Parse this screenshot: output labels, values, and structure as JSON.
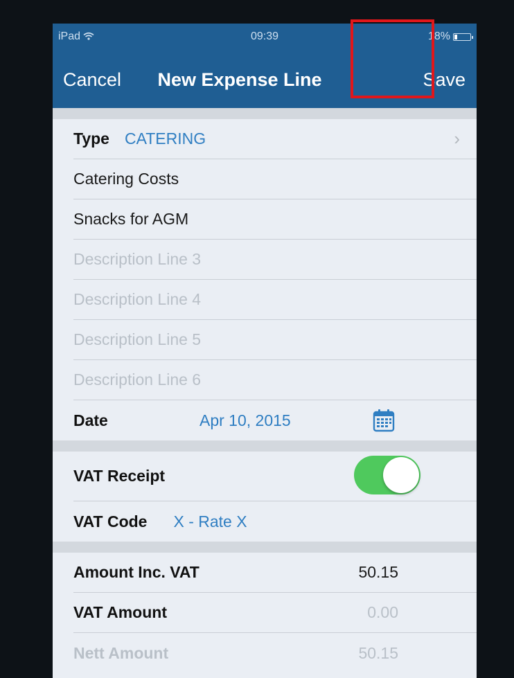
{
  "status_bar": {
    "device": "iPad",
    "time": "09:39",
    "battery": "18%",
    "battery_level": 0.18
  },
  "nav": {
    "cancel_label": "Cancel",
    "title": "New Expense Line",
    "save_label": "Save"
  },
  "form": {
    "type_label": "Type",
    "type_value": "CATERING",
    "description_1": "Catering Costs",
    "description_2": "Snacks for AGM",
    "description_3_placeholder": "Description Line 3",
    "description_4_placeholder": "Description Line 4",
    "description_5_placeholder": "Description Line 5",
    "description_6_placeholder": "Description Line 6",
    "date_label": "Date",
    "date_value": "Apr 10, 2015"
  },
  "vat": {
    "receipt_label": "VAT Receipt",
    "receipt_on": true,
    "code_label": "VAT Code",
    "code_value": "X - Rate X"
  },
  "amounts": {
    "inc_vat_label": "Amount Inc. VAT",
    "inc_vat_value": "50.15",
    "vat_amount_label": "VAT Amount",
    "vat_amount_value": "0.00",
    "nett_label": "Nett Amount",
    "nett_value": "50.15"
  },
  "colors": {
    "nav_background": "#1f5e93",
    "accent": "#2f7ec2",
    "switch_on": "#4fc95d",
    "highlight": "#e0171b"
  },
  "icons": [
    "wifi-icon",
    "battery-icon",
    "chevron-right-icon",
    "calendar-icon"
  ]
}
